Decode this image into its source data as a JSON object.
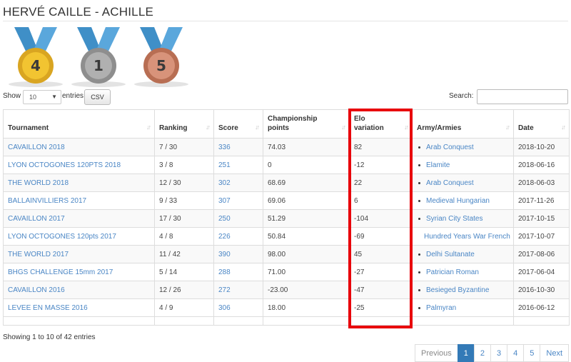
{
  "header": {
    "title": "HERVÉ CAILLE - ACHILLE"
  },
  "medals": [
    {
      "count": "4",
      "color": "#f2c431"
    },
    {
      "count": "1",
      "color": "#a8a8a8"
    },
    {
      "count": "5",
      "color": "#d18a6c"
    }
  ],
  "controls": {
    "show_label": "Show",
    "entries_value": "10",
    "entries_label": "entries",
    "csv_label": "CSV",
    "search_label": "Search:",
    "search_value": ""
  },
  "table": {
    "columns": [
      "Tournament",
      "Ranking",
      "Score",
      "Championship points",
      "Elo variation",
      "Army/Armies",
      "Date"
    ],
    "rows": [
      {
        "tournament": "CAVAILLON 2018",
        "ranking": "7 / 30",
        "score": "336",
        "points": "74.03",
        "elo": "82",
        "army": "Arab Conquest",
        "date": "2018-10-20"
      },
      {
        "tournament": "LYON OCTOGONES 120PTS 2018",
        "ranking": "3 / 8",
        "score": "251",
        "points": "0",
        "elo": "-12",
        "army": "Elamite",
        "date": "2018-06-16"
      },
      {
        "tournament": "THE WORLD 2018",
        "ranking": "12 / 30",
        "score": "302",
        "points": "68.69",
        "elo": "22",
        "army": "Arab Conquest",
        "date": "2018-06-03"
      },
      {
        "tournament": "BALLAINVILLIERS 2017",
        "ranking": "9 / 33",
        "score": "307",
        "points": "69.06",
        "elo": "6",
        "army": "Medieval Hungarian",
        "date": "2017-11-26"
      },
      {
        "tournament": "CAVAILLON 2017",
        "ranking": "17 / 30",
        "score": "250",
        "points": "51.29",
        "elo": "-104",
        "army": "Syrian City States",
        "date": "2017-10-15"
      },
      {
        "tournament": "LYON OCTOGONES 120pts 2017",
        "ranking": "4 / 8",
        "score": "226",
        "points": "50.84",
        "elo": "-69",
        "army": "Hundred Years War French",
        "date": "2017-10-07"
      },
      {
        "tournament": "THE WORLD 2017",
        "ranking": "11 / 42",
        "score": "390",
        "points": "98.00",
        "elo": "45",
        "army": "Delhi Sultanate",
        "date": "2017-08-06"
      },
      {
        "tournament": "BHGS CHALLENGE 15mm 2017",
        "ranking": "5 / 14",
        "score": "288",
        "points": "71.00",
        "elo": "-27",
        "army": "Patrician Roman",
        "date": "2017-06-04"
      },
      {
        "tournament": "CAVAILLON 2016",
        "ranking": "12 / 26",
        "score": "272",
        "points": "-23.00",
        "elo": "-47",
        "army": "Besieged Byzantine",
        "date": "2016-10-30"
      },
      {
        "tournament": "LEVEE EN MASSE 2016",
        "ranking": "4 / 9",
        "score": "306",
        "points": "18.00",
        "elo": "-25",
        "army": "Palmyran",
        "date": "2016-06-12"
      }
    ]
  },
  "footer": {
    "info": "Showing 1 to 10 of 42 entries",
    "pagination": {
      "previous": "Previous",
      "pages": [
        "1",
        "2",
        "3",
        "4",
        "5"
      ],
      "next": "Next",
      "active": "1"
    }
  },
  "highlight_color": "#e8000b"
}
